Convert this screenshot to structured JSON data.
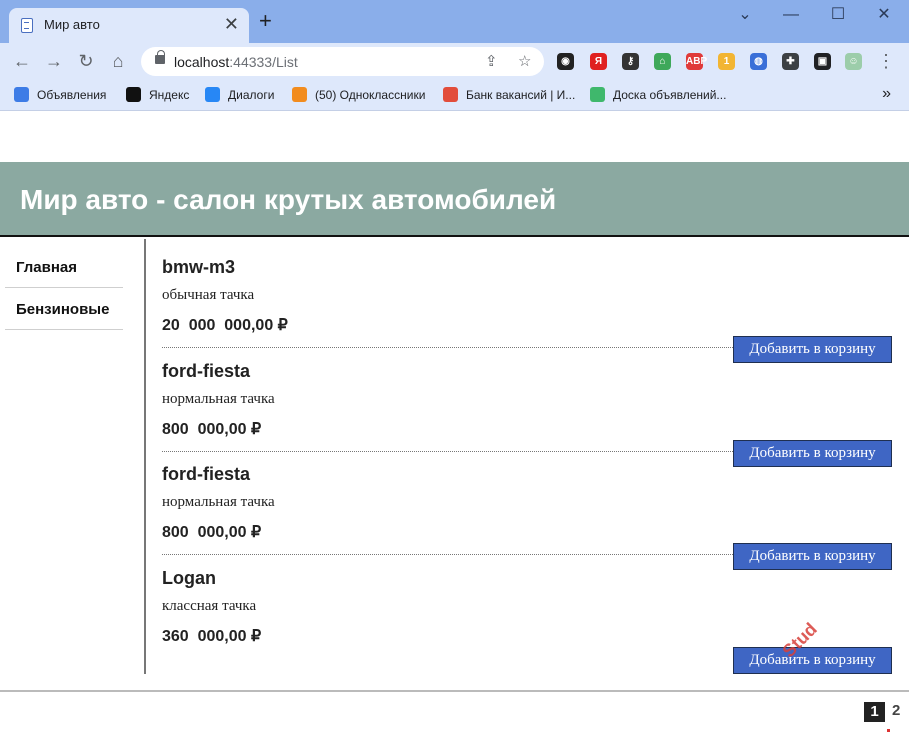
{
  "browser": {
    "tab_title": "Мир авто",
    "tab_close": "✕",
    "new_tab": "+",
    "url_host": "localhost",
    "url_rest": ":44333/List",
    "window_controls": {
      "minimize": "—",
      "maximize": "☐",
      "close": "✕",
      "collapse": "⌄"
    },
    "bookmarks": [
      {
        "label": "Объявления",
        "color": "#3d7ce6"
      },
      {
        "label": "Яндекс",
        "color": "#111111"
      },
      {
        "label": "Диалоги",
        "color": "#2787f5"
      },
      {
        "label": "(50) Одноклассники",
        "color": "#f28c1e"
      },
      {
        "label": "Банк вакансий | И...",
        "color": "#e24d3b"
      },
      {
        "label": "Доска объявлений...",
        "color": "#3fb86c"
      }
    ],
    "extensions": [
      {
        "icon": "ext-mask-icon",
        "color": "#222222",
        "text": "◉"
      },
      {
        "icon": "ext-yandex-icon",
        "color": "#e02020",
        "text": "Я"
      },
      {
        "icon": "ext-key-icon",
        "color": "#333333",
        "text": "⚷"
      },
      {
        "icon": "ext-home-icon",
        "color": "#3ea85a",
        "text": "⌂"
      },
      {
        "icon": "ext-abp-icon",
        "color": "#e03a3a",
        "text": "ABP"
      },
      {
        "icon": "ext-cookie-icon",
        "color": "#f2b533",
        "text": "1"
      },
      {
        "icon": "ext-globe-icon",
        "color": "#3a6fd8",
        "text": "◍"
      },
      {
        "icon": "ext-puzzle-icon",
        "color": "#3c4043",
        "text": "✚"
      },
      {
        "icon": "ext-sidepanel-icon",
        "color": "#202124",
        "text": "▣"
      },
      {
        "icon": "profile-avatar-icon",
        "color": "#9ccdaa",
        "text": "☺"
      }
    ]
  },
  "site": {
    "header_title": "Мир авто - салон крутых автомобилей",
    "nav": [
      "Главная",
      "Бензиновые"
    ]
  },
  "cars": [
    {
      "name": "bmw-m3",
      "desc": "обычная тачка",
      "price": "20  000  000,00 ₽",
      "button": "Добавить в корзину"
    },
    {
      "name": "ford-fiesta",
      "desc": "нормальная тачка",
      "price": "800  000,00 ₽",
      "button": "Добавить в корзину"
    },
    {
      "name": "ford-fiesta",
      "desc": "нормальная тачка",
      "price": "800  000,00 ₽",
      "button": "Добавить в корзину"
    },
    {
      "name": "Logan",
      "desc": "классная тачка",
      "price": "360  000,00 ₽",
      "button": "Добавить в корзину"
    }
  ],
  "pagination": {
    "current": "1",
    "next": "2"
  },
  "watermark": "Stud"
}
